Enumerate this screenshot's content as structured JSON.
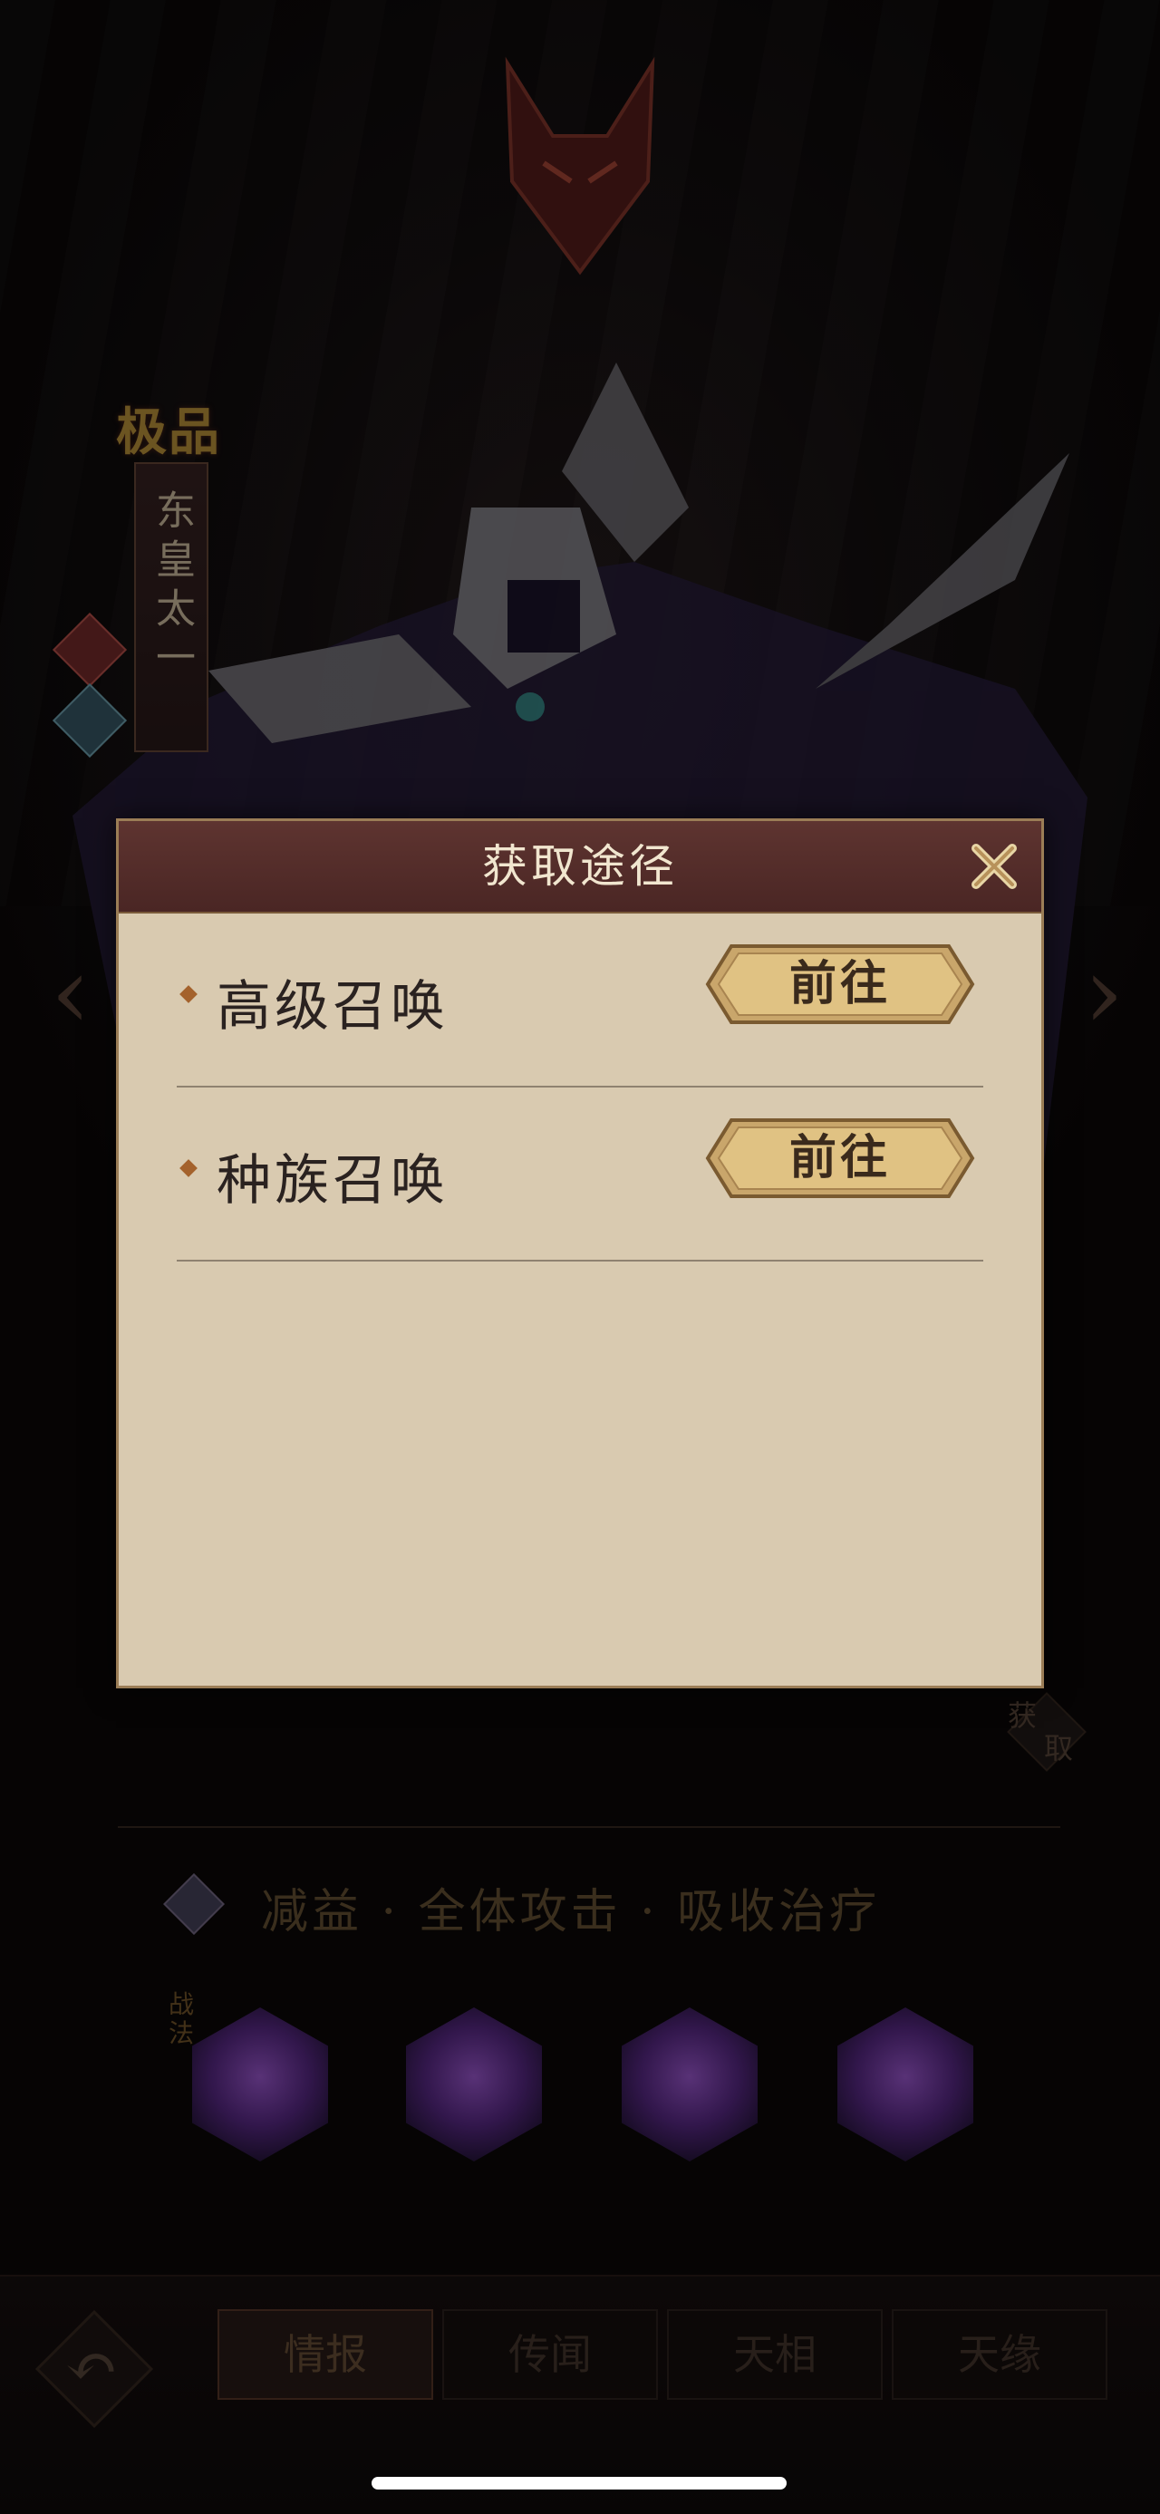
{
  "hero": {
    "grade": "极品",
    "name": "东皇太一"
  },
  "dialog": {
    "title": "获取途径",
    "rows": [
      {
        "label": "高级召唤",
        "button": "前往"
      },
      {
        "label": "种族召唤",
        "button": "前往"
      }
    ]
  },
  "acquire": {
    "top": "获",
    "bottom": "取"
  },
  "tags_line": "减益 · 全体攻击 · 吸收治疗",
  "skills_label": "战法",
  "tabs": [
    "情报",
    "传闻",
    "天相",
    "天缘"
  ],
  "active_tab": "情报"
}
